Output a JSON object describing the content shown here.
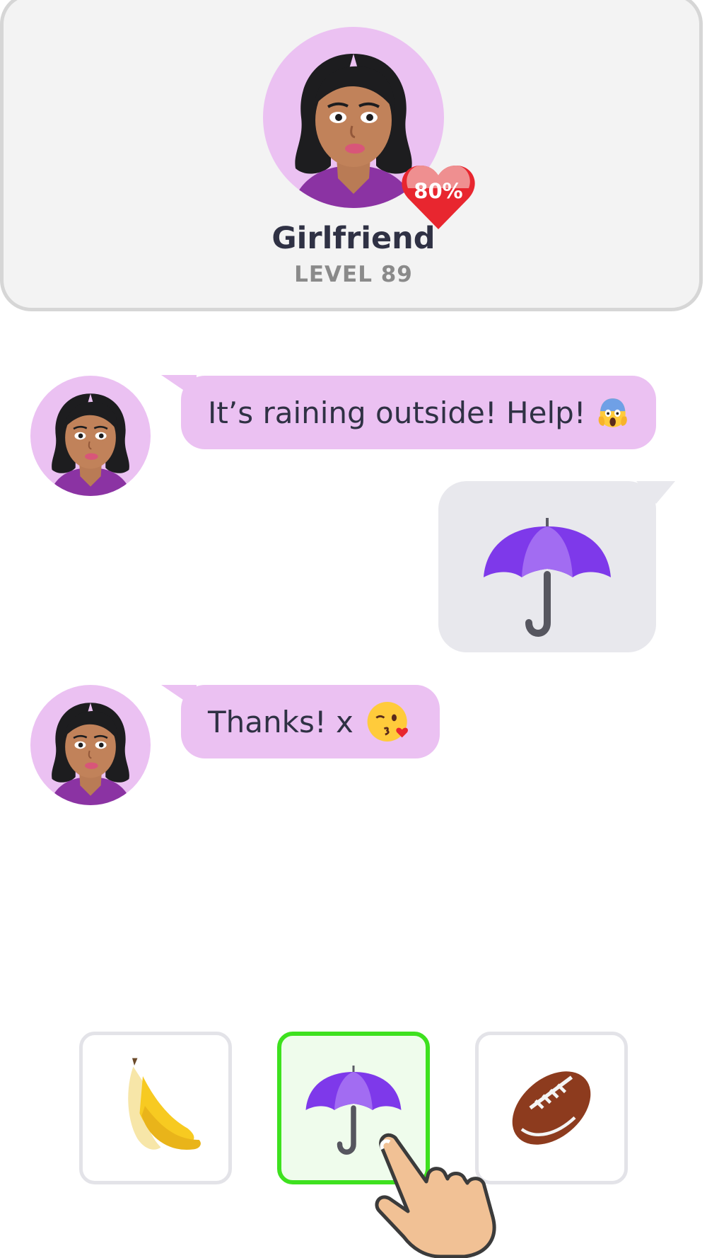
{
  "header": {
    "name": "Girlfriend",
    "level": "LEVEL 89",
    "affection": "80%"
  },
  "messages": [
    {
      "from": "character",
      "text": "It’s raining outside! Help!",
      "emoji": "face-screaming-in-fear-icon"
    },
    {
      "from": "player",
      "emoji": "umbrella-icon"
    },
    {
      "from": "character",
      "text": "Thanks! x",
      "emoji": "face-blowing-kiss-icon"
    }
  ],
  "choices": [
    {
      "emoji": "banana-icon",
      "selected": false
    },
    {
      "emoji": "umbrella-icon",
      "selected": true
    },
    {
      "emoji": "american-football-icon",
      "selected": false
    }
  ],
  "colors": {
    "card_bg": "#f3f3f3",
    "card_border": "#d6d6d6",
    "avatar_bg": "#ebc1f2",
    "character_bubble": "#ebc1f2",
    "player_bubble": "#e8e8ed",
    "heart": "#e8262f",
    "selected_border": "#3ee11f",
    "text_dark": "#2f3144",
    "text_muted": "#8a8a8a"
  }
}
